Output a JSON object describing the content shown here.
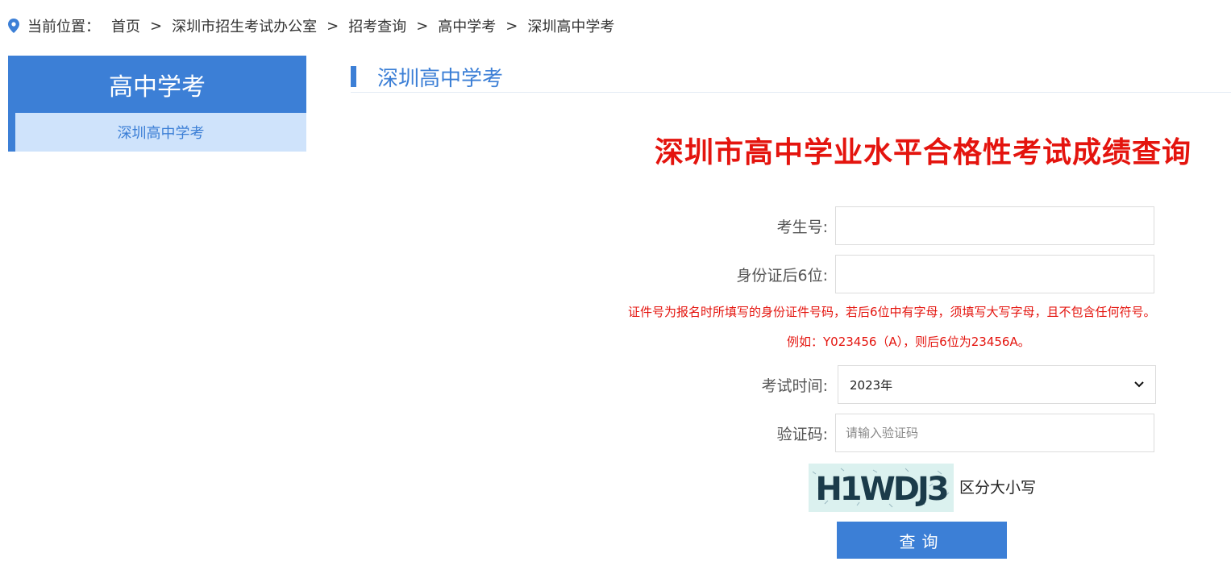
{
  "breadcrumb": {
    "prefix": "当前位置：",
    "items": [
      "首页",
      "深圳市招生考试办公室",
      "招考查询",
      "高中学考",
      "深圳高中学考"
    ],
    "separator": ">"
  },
  "sidebar": {
    "title": "高中学考",
    "items": [
      {
        "label": "深圳高中学考"
      }
    ]
  },
  "section": {
    "title": "深圳高中学考"
  },
  "form": {
    "title": "深圳市高中学业水平合格性考试成绩查询",
    "exam_number": {
      "label": "考生号:",
      "value": "",
      "placeholder": ""
    },
    "id_last6": {
      "label": "身份证后6位:",
      "value": "",
      "placeholder": ""
    },
    "hint_line1": "证件号为报名时所填写的身份证件号码，若后6位中有字母，须填写大写字母，且不包含任何符号。",
    "hint_line2": "例如：Y023456（A），则后6位为23456A。",
    "exam_time": {
      "label": "考试时间:",
      "selected": "2023年"
    },
    "captcha": {
      "label": "验证码:",
      "placeholder": "请输入验证码",
      "value": ""
    },
    "captcha_image_text": "H1WDJ3",
    "captcha_note": "区分大小写",
    "submit_label": "查询"
  },
  "colors": {
    "accent": "#3c7fd6",
    "title_red": "#e4140e",
    "sidebar_active_bg": "#cfe3fb"
  }
}
